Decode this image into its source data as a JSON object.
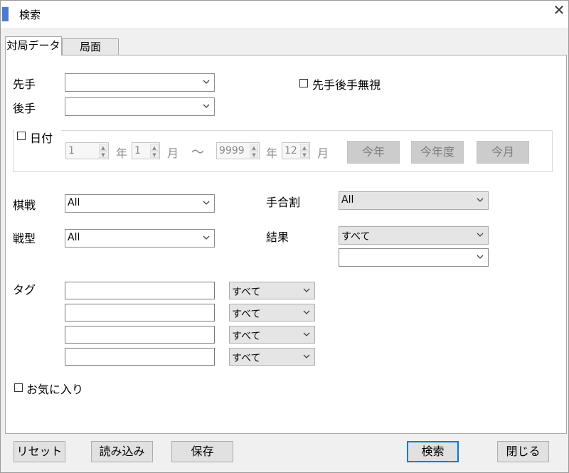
{
  "window": {
    "title": "検索",
    "close_glyph": "✕"
  },
  "tabs": [
    {
      "label": "対局データ",
      "active": true
    },
    {
      "label": "局面",
      "active": false
    }
  ],
  "players": {
    "sente_label": "先手",
    "gote_label": "後手",
    "ignore_label": "先手後手無視",
    "sente_value": "",
    "gote_value": ""
  },
  "date": {
    "label": "日付",
    "from_year": "1",
    "from_month": "1",
    "to_year": "9999",
    "to_month": "12",
    "year_unit": "年",
    "month_unit": "月",
    "tilde": "～",
    "btn_this_year": "今年",
    "btn_this_fiscal": "今年度",
    "btn_this_month": "今月"
  },
  "filters": {
    "kisen_label": "棋戦",
    "kisen_value": "All",
    "senkei_label": "戦型",
    "senkei_value": "All",
    "teai_label": "手合割",
    "teai_value": "All",
    "result_label": "結果",
    "result_value": "すべて",
    "result_sub_value": ""
  },
  "tags": {
    "label": "タグ",
    "rows": [
      {
        "text": "",
        "mode": "すべて"
      },
      {
        "text": "",
        "mode": "すべて"
      },
      {
        "text": "",
        "mode": "すべて"
      },
      {
        "text": "",
        "mode": "すべて"
      }
    ]
  },
  "favorite_label": "お気に入り",
  "footer": {
    "reset": "リセット",
    "load": "読み込み",
    "save": "保存",
    "search": "検索",
    "close": "閉じる"
  },
  "colors": {
    "accent": "#4a7bd0",
    "focus_border": "#0078d7"
  },
  "icons": {
    "spin_up": "▲",
    "spin_down": "▼"
  }
}
